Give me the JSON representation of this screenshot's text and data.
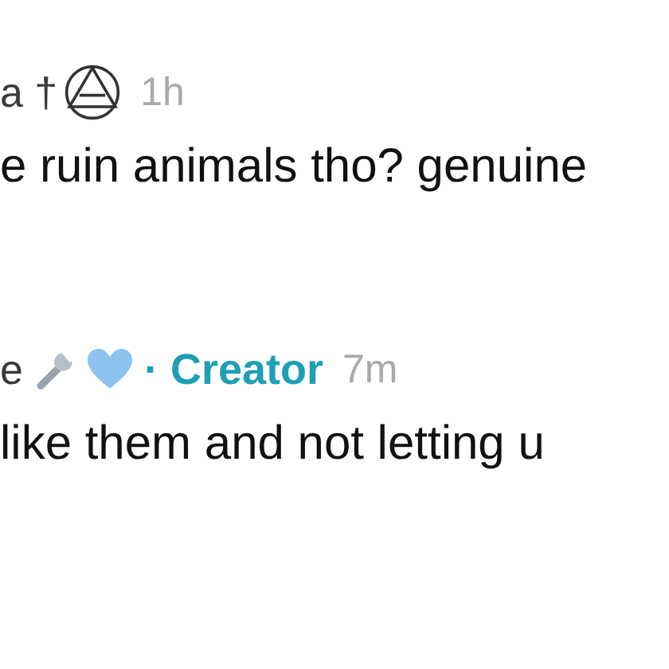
{
  "comments": [
    {
      "author": "a †",
      "badges": [
        {
          "kind": "triangle"
        }
      ],
      "time": "1h",
      "text": "e ruin animals tho? genuine"
    },
    {
      "author": "e",
      "badges": [
        {
          "kind": "wrench"
        },
        {
          "kind": "heart"
        }
      ],
      "role": "· Creator",
      "time": "7m",
      "text": "like them and not letting u"
    }
  ]
}
